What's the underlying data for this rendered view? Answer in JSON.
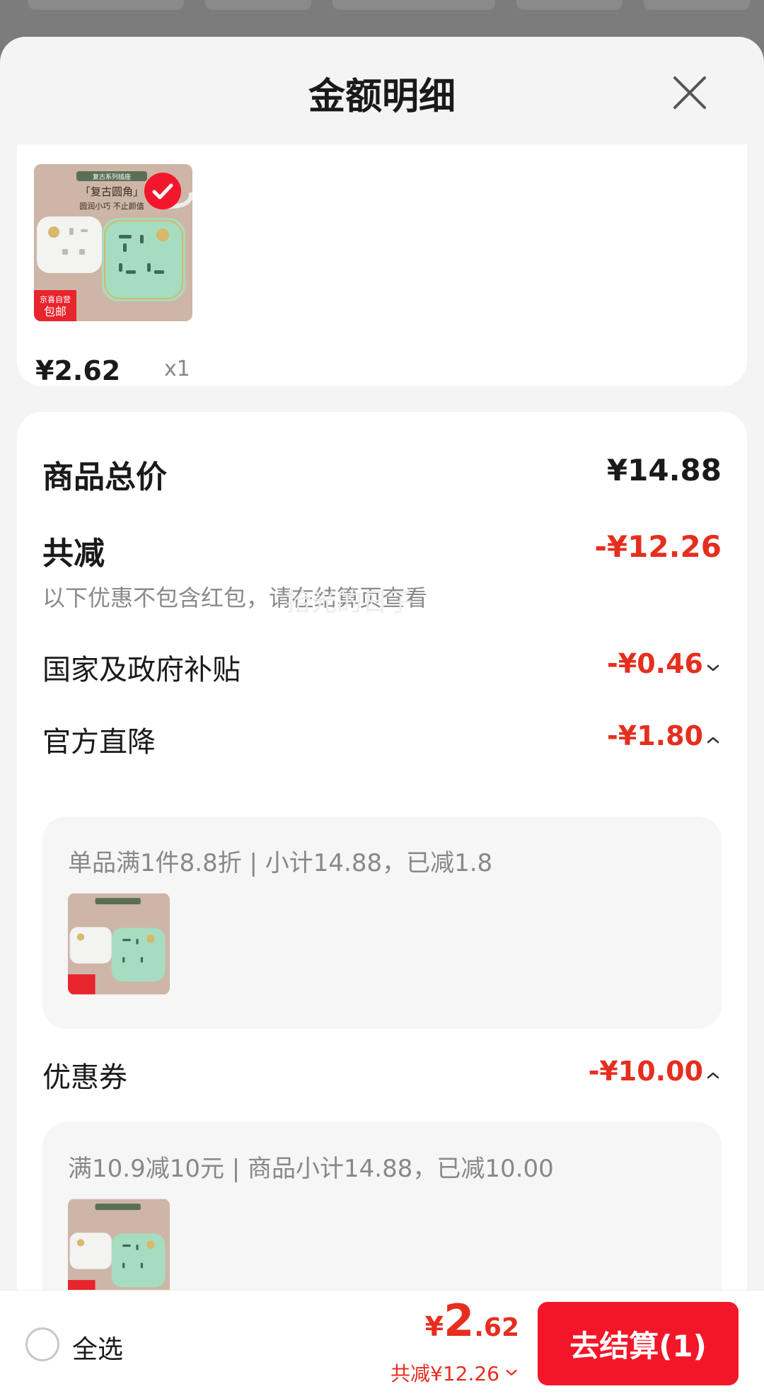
{
  "sheet": {
    "title": "金额明细"
  },
  "products": {
    "items": [
      {
        "price": "¥2.62",
        "quantity": "x1"
      }
    ]
  },
  "thumbnail": {
    "banner": "复古系列插座",
    "headline": "「复古圆角」",
    "tagline": "圆润小巧 不止颜值",
    "tag_top": "京喜自营",
    "tag_bottom": "包邮"
  },
  "summary": {
    "total_label": "商品总价",
    "total_value": "¥14.88",
    "discount_label": "共减",
    "discount_value": "-¥12.26",
    "note": "以下优惠不包含红包，请在结算页查看",
    "watermark": "拾光的日子"
  },
  "discounts": [
    {
      "label": "国家及政府补贴",
      "value": "-¥0.46",
      "expanded": false
    },
    {
      "label": "官方直降",
      "value": "-¥1.80",
      "expanded": true,
      "detail": "单品满1件8.8折 | 小计14.88，已减1.8"
    },
    {
      "label": "优惠券",
      "value": "-¥10.00",
      "expanded": true,
      "detail": "满10.9减10元 | 商品小计14.88，已减10.00"
    }
  ],
  "bottom_bar": {
    "select_all_label": "全选",
    "total_symbol": "¥",
    "total_integer": "2",
    "total_decimal": ".62",
    "saving_text": "共减¥12.26",
    "checkout_label": "去结算(1)"
  },
  "colors": {
    "accent_red": "#e62e1f",
    "button_red": "#f31628",
    "product_green": "#9ed9b8"
  }
}
